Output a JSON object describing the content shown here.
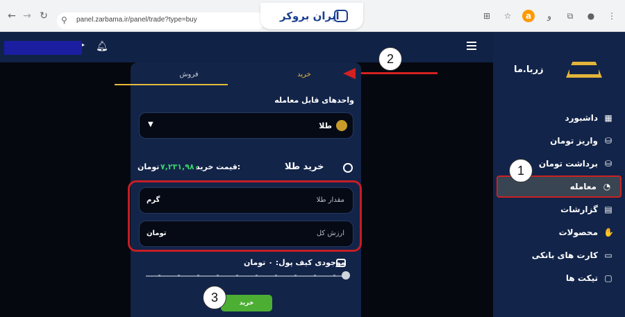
{
  "browser": {
    "url": "panel.zarbama.ir/panel/trade?type=buy",
    "watermark_text": "ایران بروکر",
    "icons": [
      "back-icon",
      "forward-icon",
      "reload-icon",
      "site-info-icon",
      "translate-icon",
      "bookmark-star-icon",
      "amazon-extension-icon",
      "extension-icon",
      "extensions-puzzle-icon",
      "profile-icon",
      "more-icon"
    ]
  },
  "topbar": {
    "icons": [
      "user-menu-caret-icon",
      "notification-bell-icon",
      "hamburger-menu-icon"
    ]
  },
  "sidebar": {
    "logo_text": "زربا.ما",
    "items": [
      {
        "label": "داشبورد",
        "icon": "dashboard-grid-icon"
      },
      {
        "label": "واریز تومان",
        "icon": "deposit-icon"
      },
      {
        "label": "برداشت تومان",
        "icon": "withdraw-icon"
      },
      {
        "label": "معامله",
        "icon": "trade-icon",
        "active": true
      },
      {
        "label": "گزارشات",
        "icon": "reports-icon"
      },
      {
        "label": "محصولات",
        "icon": "products-icon"
      },
      {
        "label": "کارت های بانکی",
        "icon": "bank-card-icon"
      },
      {
        "label": "تیکت ها",
        "icon": "ticket-icon"
      }
    ]
  },
  "trade": {
    "tabs": [
      {
        "label": "خرید",
        "active": true
      },
      {
        "label": "فروش",
        "active": false
      }
    ],
    "tradable_units_label": "واحدهای قابل معامله",
    "selected_asset": "طلا",
    "buy_title": "خرید طلا",
    "buy_price_label": "قیمت خرید:",
    "buy_price_value": "۷,۲۳۱,۹۸۰",
    "buy_price_unit": "تومان",
    "amount_placeholder": "مقدار طلا",
    "amount_unit": "گرم",
    "value_placeholder": "ارزش کل",
    "value_unit": "تومان",
    "wallet_balance": "موجودی کیف پول: ۰ تومان",
    "buy_button": "خرید",
    "slider_level": 1.0
  },
  "annotations": {
    "callout_1": "1",
    "callout_2": "2",
    "callout_3": "3",
    "colors": {
      "highlight": "#c51e24",
      "accent": "#e6bb3c",
      "price": "#39d16c",
      "button": "#4caf33"
    }
  }
}
